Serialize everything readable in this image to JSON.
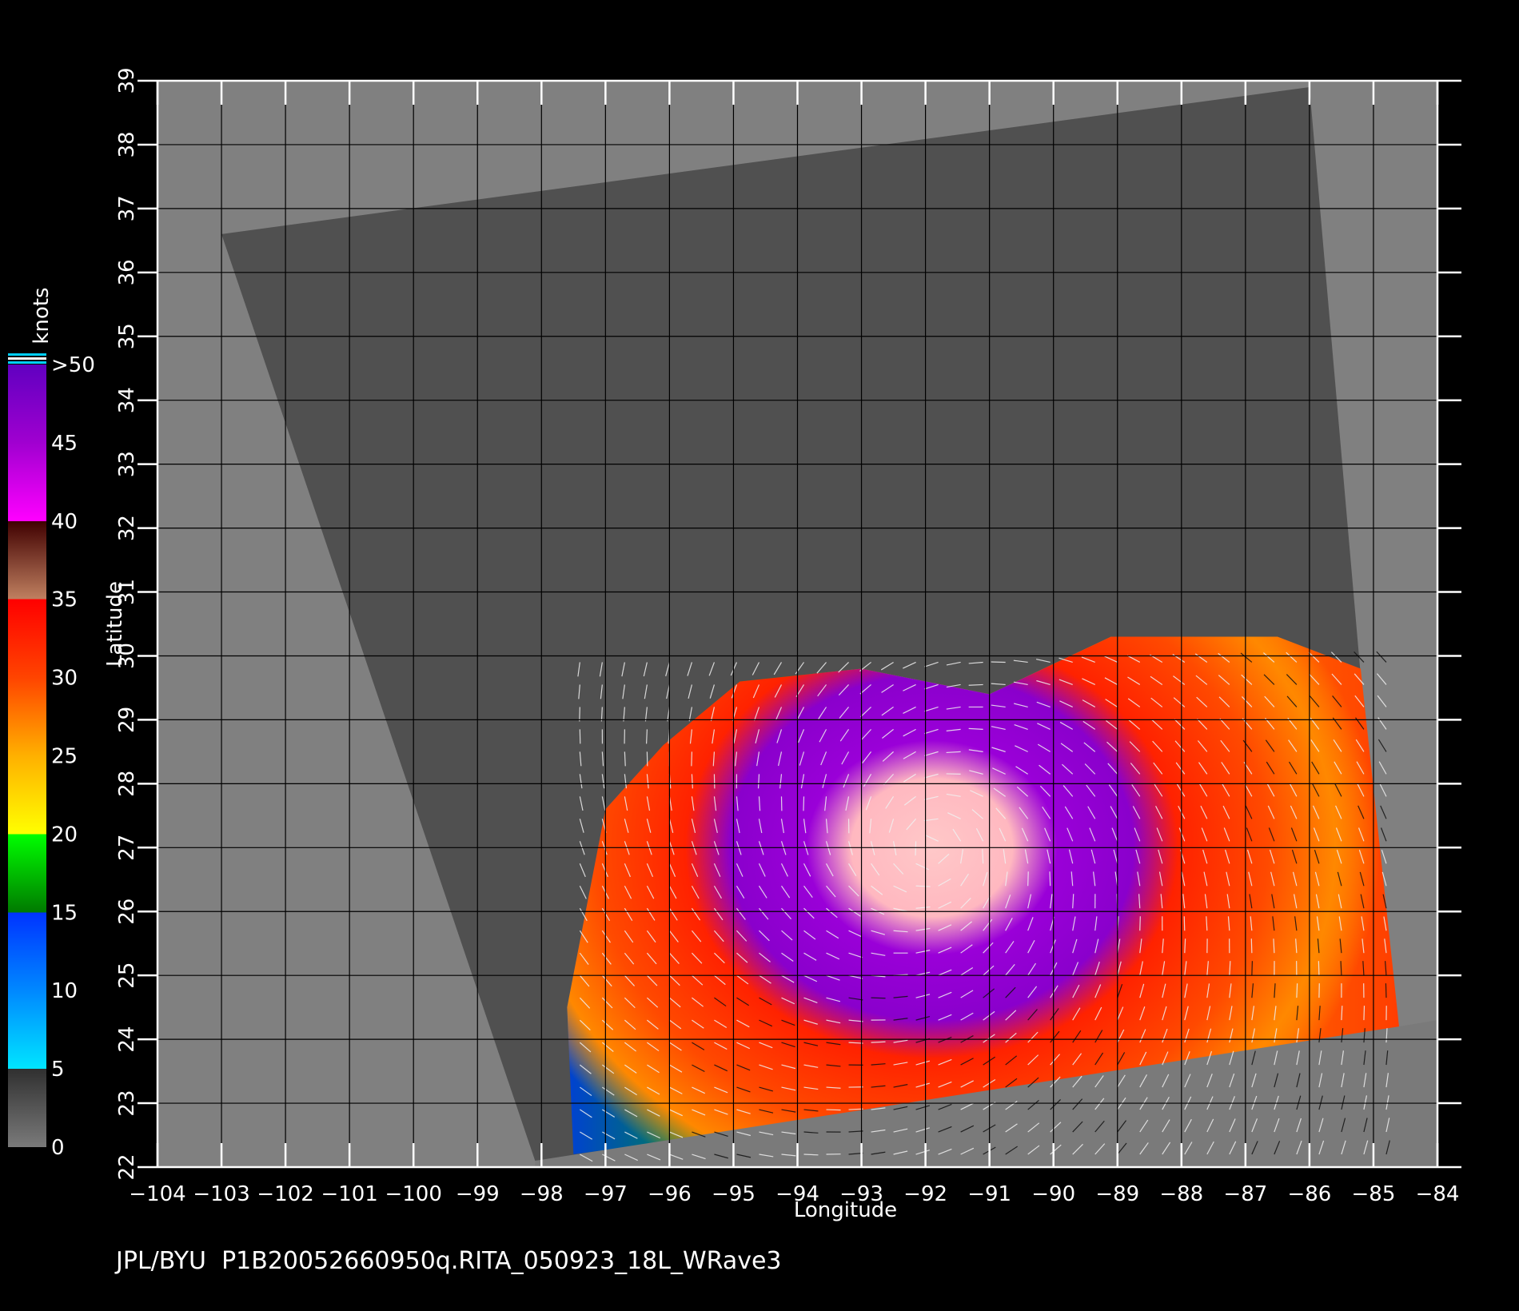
{
  "chart_data": {
    "type": "heatmap",
    "xlabel": "Longitude",
    "ylabel": "Latitude",
    "xlim": [
      -104,
      -84
    ],
    "ylim": [
      22,
      39
    ],
    "x_ticks": [
      -104,
      -103,
      -102,
      -101,
      -100,
      -99,
      -98,
      -97,
      -96,
      -95,
      -94,
      -93,
      -92,
      -91,
      -90,
      -89,
      -88,
      -87,
      -86,
      -85,
      -84
    ],
    "y_ticks": [
      22,
      23,
      24,
      25,
      26,
      27,
      28,
      29,
      30,
      31,
      32,
      33,
      34,
      35,
      36,
      37,
      38,
      39
    ],
    "grid": true,
    "colorbar": {
      "unit": "knots",
      "min": 0,
      "max": 50,
      "labels": [
        "0",
        "5",
        "10",
        "15",
        "20",
        "25",
        "30",
        "35",
        "40",
        "45",
        ">50"
      ],
      "stops": [
        {
          "value": 0,
          "color": "#7a7a7a"
        },
        {
          "value": 5,
          "color": "#303030"
        },
        {
          "value": 5,
          "color": "#00e5ff"
        },
        {
          "value": 10,
          "color": "#0088ff"
        },
        {
          "value": 15,
          "color": "#0033ff"
        },
        {
          "value": 15,
          "color": "#007a00"
        },
        {
          "value": 20,
          "color": "#00ff00"
        },
        {
          "value": 20,
          "color": "#ffff00"
        },
        {
          "value": 25,
          "color": "#ffb000"
        },
        {
          "value": 30,
          "color": "#ff4400"
        },
        {
          "value": 35,
          "color": "#ff0000"
        },
        {
          "value": 35,
          "color": "#c08060"
        },
        {
          "value": 40,
          "color": "#400000"
        },
        {
          "value": 40,
          "color": "#ff00ff"
        },
        {
          "value": 45,
          "color": "#a000d0"
        },
        {
          "value": 50,
          "color": "#6000c0"
        }
      ]
    },
    "swath_corners_deg": [
      [
        -103.0,
        36.6
      ],
      [
        -86.0,
        38.9
      ],
      [
        -84.6,
        22.8
      ],
      [
        -98.1,
        22.1
      ]
    ],
    "storm_center_deg": [
      -91.9,
      27.0
    ]
  },
  "footer": {
    "credit": "JPL/BYU",
    "filename": "P1B20052660950q.RITA_050923_18L_WRave3"
  },
  "colors": {
    "background": "#000000",
    "no_data": "#808080",
    "swath": "#505050",
    "grid": "#000000",
    "land_mask": "#7a7a7a"
  }
}
